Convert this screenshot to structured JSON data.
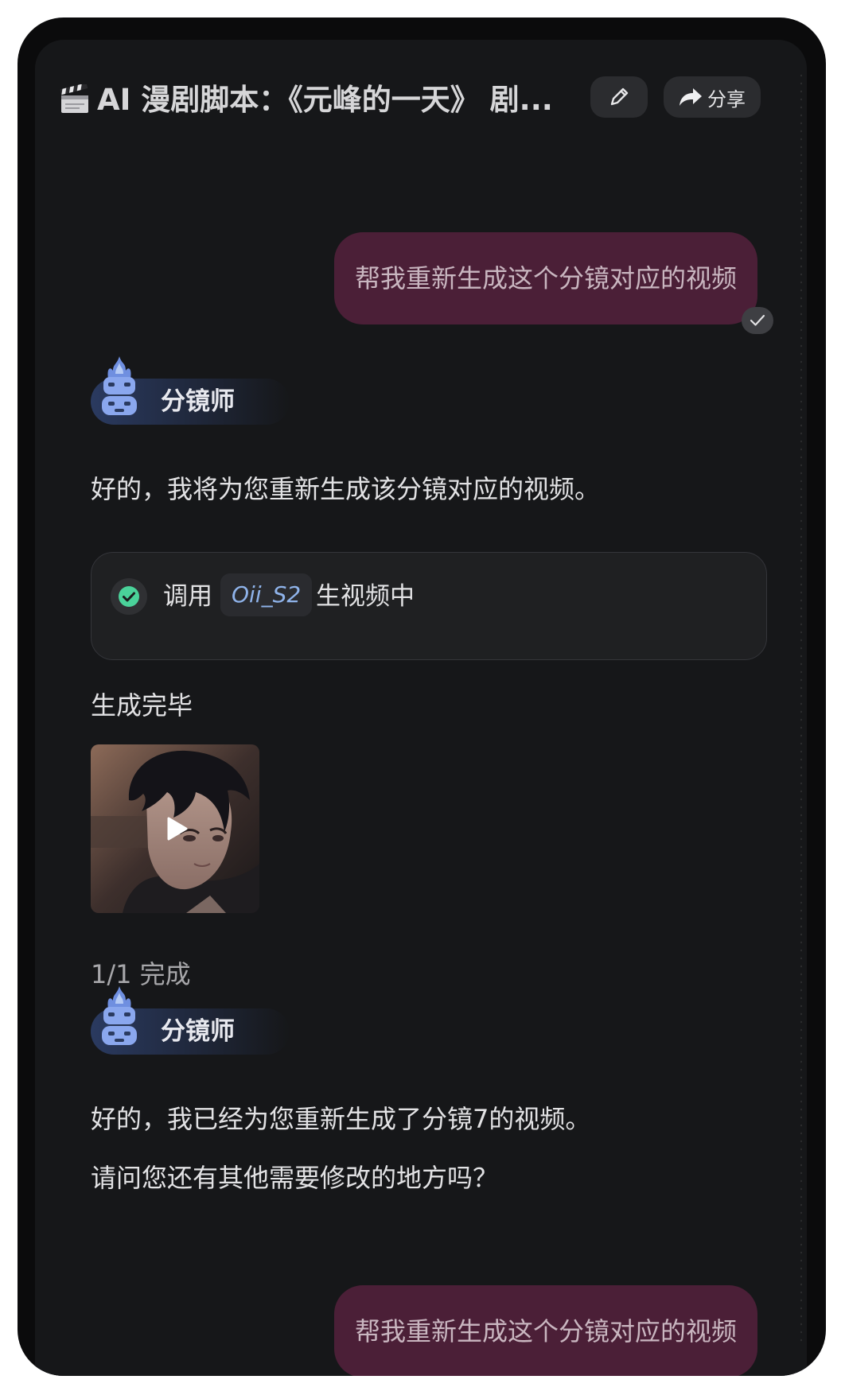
{
  "header": {
    "title": "AI 漫剧脚本：《元峰的一天》 剧...",
    "clapper_icon": "clapperboard-icon",
    "edit_icon": "pencil-icon",
    "share_label": "分享",
    "share_icon": "share-arrow-icon"
  },
  "messages": [
    {
      "role": "user",
      "text": "帮我重新生成这个分镜对应的视频",
      "read_icon": "checkmark-icon"
    },
    {
      "role": "agent",
      "agent_name": "分镜师",
      "text": "好的，我将为您重新生成该分镜对应的视频。",
      "tool_call": {
        "status_icon": "check-circle-icon",
        "prefix": "调用",
        "model": "Oii_S2",
        "suffix": "生视频中"
      },
      "result_label": "生成完毕",
      "video": {
        "icon": "play-icon"
      },
      "progress": "1/1 完成"
    },
    {
      "role": "agent",
      "agent_name": "分镜师",
      "text": "好的，我已经为您重新生成了分镜7的视频。",
      "text2": "请问您还有其他需要修改的地方吗？"
    },
    {
      "role": "user",
      "text": "帮我重新生成这个分镜对应的视频"
    }
  ],
  "colors": {
    "background": "#161719",
    "user_bubble": "#4b1f37",
    "tool_success": "#4ad29a",
    "model_chip_text": "#8fb3ea"
  }
}
